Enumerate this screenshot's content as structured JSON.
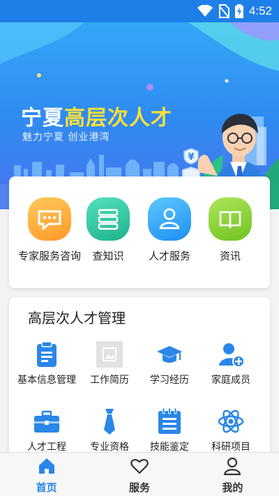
{
  "status_bar": {
    "time": "4:52"
  },
  "banner": {
    "title_part1": "宁夏",
    "title_part2": "高层次人才",
    "subtitle": "魅力宁夏 创业港湾",
    "badge_symbol": "¥"
  },
  "services": [
    {
      "label": "专家服务咨询",
      "icon": "chat-icon",
      "color": "#ffb23e"
    },
    {
      "label": "查知识",
      "icon": "stack-icon",
      "color": "#2ec9a4"
    },
    {
      "label": "人才服务",
      "icon": "person-icon",
      "color": "#32a8f7"
    },
    {
      "label": "资讯",
      "icon": "book-icon",
      "color": "#8ed23c"
    }
  ],
  "management": {
    "title": "高层次人才管理",
    "items": [
      {
        "label": "基本信息管理",
        "icon": "clipboard-icon"
      },
      {
        "label": "工作简历",
        "icon": "image-placeholder-icon"
      },
      {
        "label": "学习经历",
        "icon": "graduation-cap-icon"
      },
      {
        "label": "家庭成员",
        "icon": "add-user-icon"
      },
      {
        "label": "人才工程",
        "icon": "briefcase-icon"
      },
      {
        "label": "专业资格",
        "icon": "tie-icon"
      },
      {
        "label": "技能鉴定",
        "icon": "notepad-icon"
      },
      {
        "label": "科研项目",
        "icon": "atom-icon"
      }
    ]
  },
  "nav": [
    {
      "label": "首页",
      "icon": "home-icon",
      "active": true
    },
    {
      "label": "服务",
      "icon": "heart-icon",
      "active": false
    },
    {
      "label": "我的",
      "icon": "user-icon",
      "active": false
    }
  ],
  "colors": {
    "accent": "#1f7fe8",
    "nav_active": "#2a86e8",
    "nav_inactive": "#333333",
    "icon_blue": "#2a86e8"
  }
}
